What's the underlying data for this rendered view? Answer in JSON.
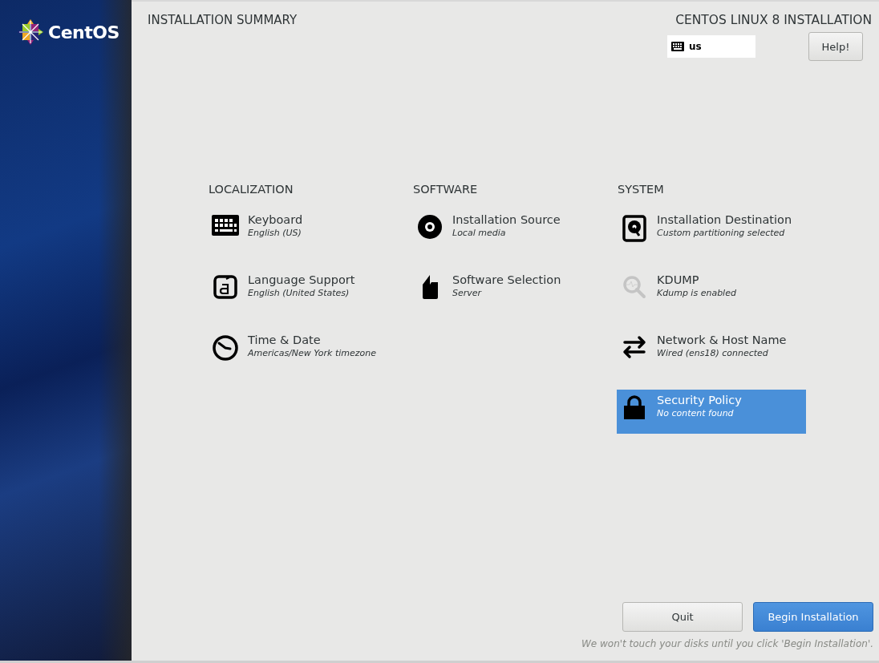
{
  "brand": {
    "name": "CentOS"
  },
  "header": {
    "title": "INSTALLATION SUMMARY",
    "product": "CENTOS LINUX 8 INSTALLATION",
    "keyboard_layout": "us",
    "help_button": "Help!"
  },
  "categories": [
    {
      "title": "LOCALIZATION",
      "spokes": [
        {
          "kind": "keyboard",
          "title": "Keyboard",
          "status": "English (US)",
          "selected": false
        },
        {
          "kind": "language",
          "title": "Language Support",
          "status": "English (United States)",
          "selected": false
        },
        {
          "kind": "clock",
          "title": "Time & Date",
          "status": "Americas/New York timezone",
          "selected": false
        }
      ]
    },
    {
      "title": "SOFTWARE",
      "spokes": [
        {
          "kind": "disc",
          "title": "Installation Source",
          "status": "Local media",
          "selected": false
        },
        {
          "kind": "package",
          "title": "Software Selection",
          "status": "Server",
          "selected": false
        }
      ]
    },
    {
      "title": "SYSTEM",
      "spokes": [
        {
          "kind": "harddisk",
          "title": "Installation Destination",
          "status": "Custom partitioning selected",
          "selected": false
        },
        {
          "kind": "kdump",
          "title": "KDUMP",
          "status": "Kdump is enabled",
          "selected": false
        },
        {
          "kind": "network",
          "title": "Network & Host Name",
          "status": "Wired (ens18) connected",
          "selected": false
        },
        {
          "kind": "lock",
          "title": "Security Policy",
          "status": "No content found",
          "selected": true
        }
      ]
    }
  ],
  "footer": {
    "buttons": [
      {
        "kind": "secondary",
        "label": "Quit"
      },
      {
        "kind": "primary",
        "label": "Begin Installation"
      }
    ],
    "note": "We won't touch your disks until you click 'Begin Installation'."
  }
}
